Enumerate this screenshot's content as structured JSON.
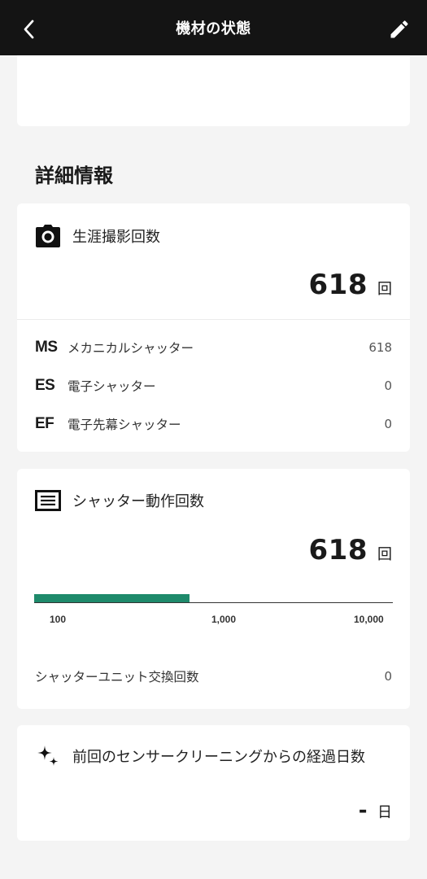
{
  "header": {
    "title": "機材の状態",
    "back_icon": "chevron-left-icon",
    "edit_icon": "pencil-icon"
  },
  "section_title": "詳細情報",
  "lifetime_shots": {
    "label": "生涯撮影回数",
    "icon": "camera-icon",
    "count": "618",
    "unit": "回",
    "rows": [
      {
        "code": "MS",
        "name": "メカニカルシャッター",
        "value": "618"
      },
      {
        "code": "ES",
        "name": "電子シャッター",
        "value": "0"
      },
      {
        "code": "EF",
        "name": "電子先幕シャッター",
        "value": "0"
      }
    ]
  },
  "shutter_actuations": {
    "label": "シャッター動作回数",
    "icon": "shutter-list-icon",
    "count": "618",
    "unit": "回",
    "bar_fraction": 0.434,
    "ticks": [
      "100",
      "1,000",
      "10,000"
    ],
    "accent_color": "#1e8a6b",
    "unit_replacement_label": "シャッターユニット交換回数",
    "unit_replacement_value": "0"
  },
  "sensor_cleaning": {
    "label": "前回のセンサークリーニングからの経過日数",
    "icon": "sparkle-icon",
    "value": "-",
    "unit": "日"
  }
}
